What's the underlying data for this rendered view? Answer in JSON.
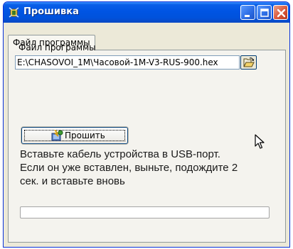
{
  "window": {
    "title": "Прошивка"
  },
  "tabs": [
    {
      "label": "Файл программы",
      "active": true
    }
  ],
  "file_section": {
    "label": "Файл программы",
    "file_path": "E:\\CHASOVOI_1M\\Часовой-1M-V3-RUS-900.hex",
    "browse_icon": "folder-open-icon"
  },
  "actions": {
    "flash_label": "Прошить",
    "flash_icon": "flash-chip-icon"
  },
  "message": {
    "lines": [
      "Вставьте кабель устройства в USB-порт.",
      "Если он уже вставлен, выньте, подождите 2",
      "сек. и вставьте вновь"
    ]
  },
  "progress": {
    "value": 0
  },
  "colors": {
    "title_bar": "#0054e3",
    "close_button": "#d9583b",
    "panel": "#f4f3ee",
    "frame": "#ece9d8"
  }
}
